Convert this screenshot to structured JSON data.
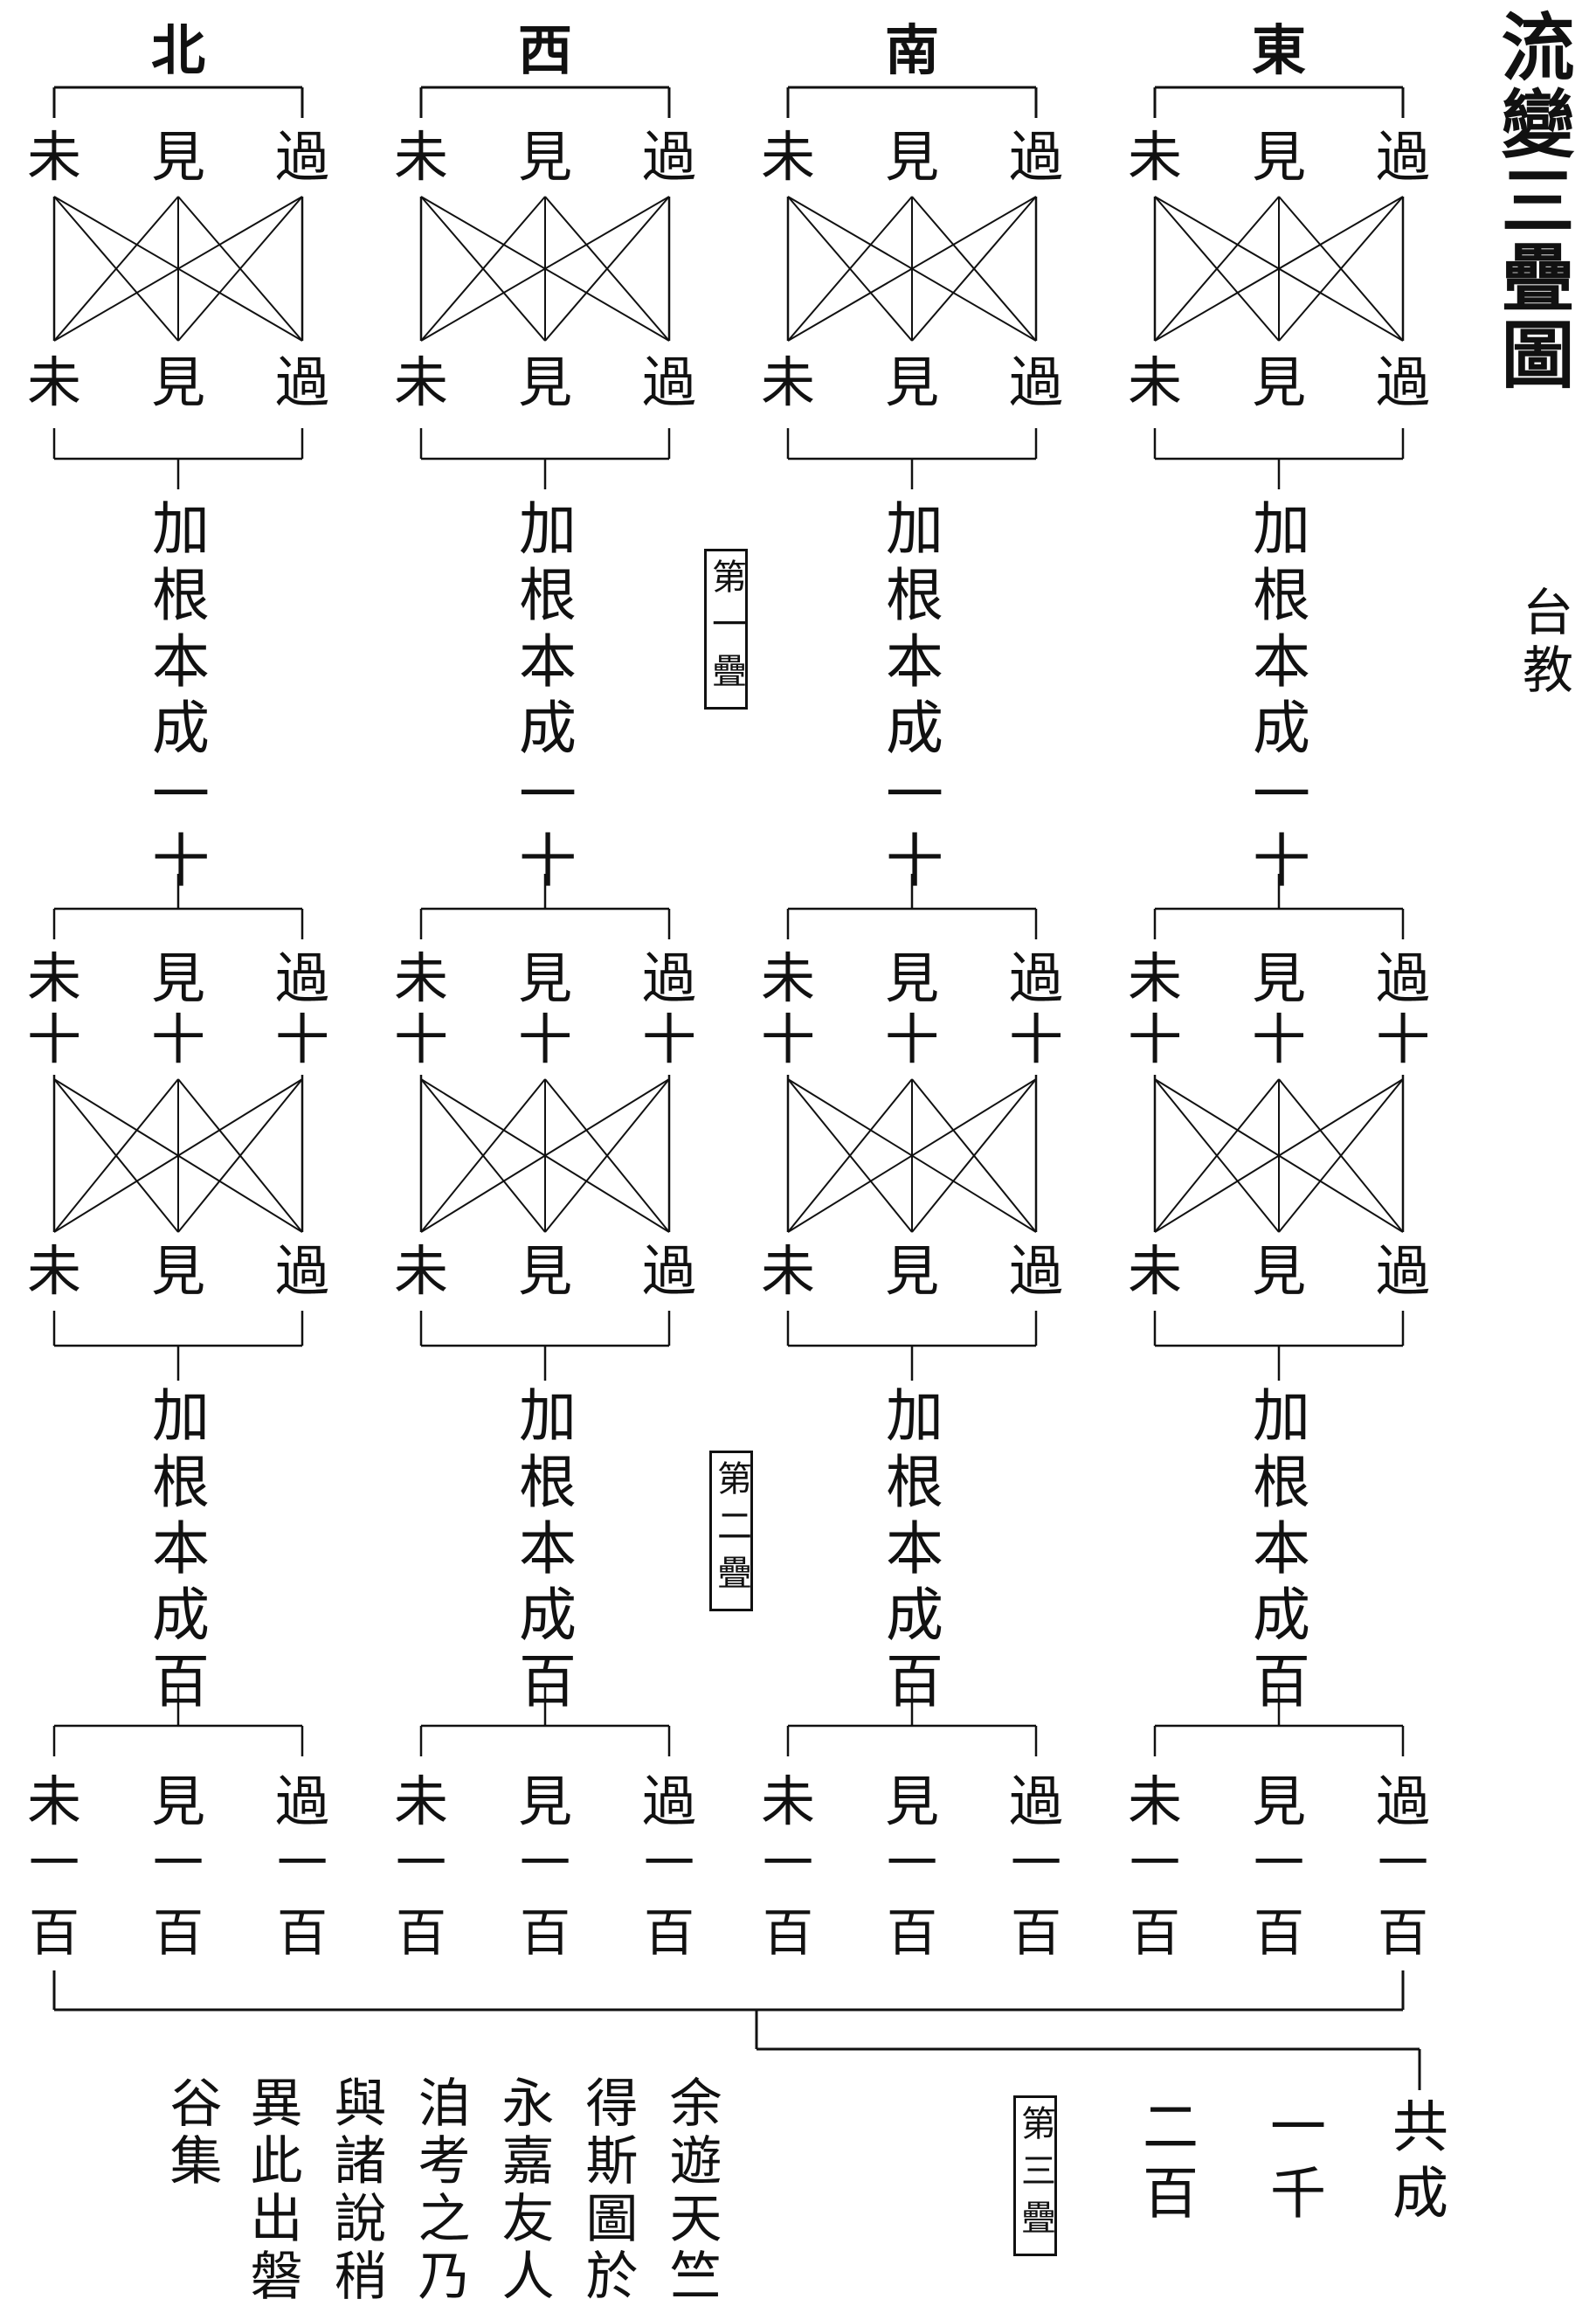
{
  "title": "流變三疊圖",
  "school": "台教",
  "directions": [
    "東",
    "南",
    "西",
    "北"
  ],
  "node_labels": {
    "past": "過",
    "present": "見",
    "future": "未"
  },
  "layers": [
    {
      "label": "第一疊",
      "add_label": "加根本成一十",
      "row_suffix": ""
    },
    {
      "label": "第二疊",
      "add_label": "加根本成百",
      "row_suffix": "十"
    },
    {
      "label": "第三疊",
      "row_suffix": "一百"
    }
  ],
  "total": {
    "label": "共成",
    "value_1": "一千",
    "value_2": "二百"
  },
  "colophon": [
    "余遊天竺",
    "得斯圖於",
    "永嘉友人",
    "洎考之乃",
    "與諸說稍",
    "異此出磐",
    "谷集"
  ]
}
